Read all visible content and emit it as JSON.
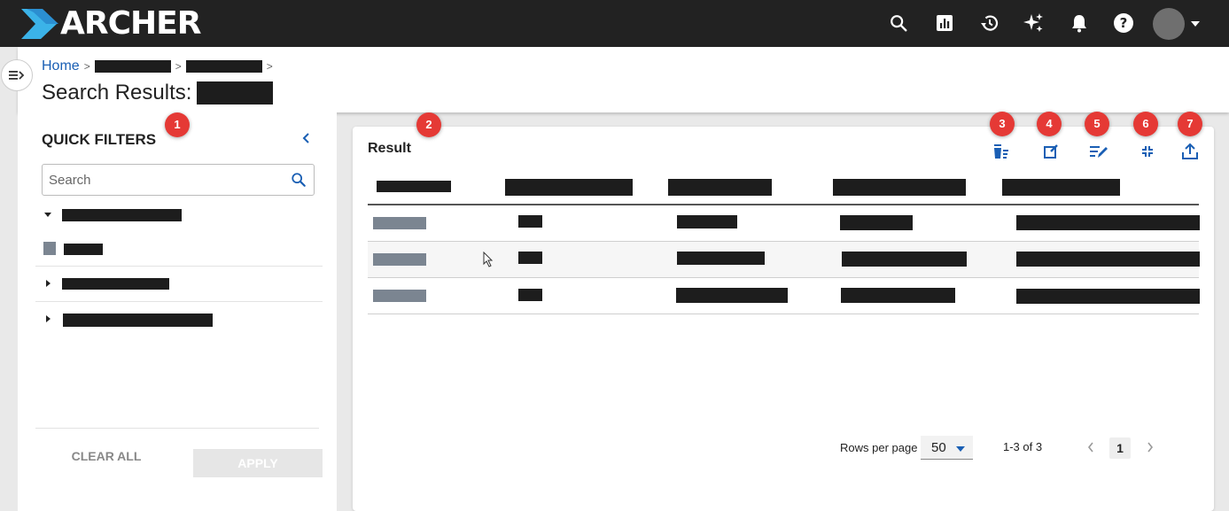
{
  "app": {
    "logo_text": "ARCHER",
    "colors": {
      "topbar": "#222222",
      "accent": "#1a5fb4",
      "badge": "#e53935"
    },
    "top_icons": [
      "search-icon",
      "reports-chart-icon",
      "history-icon",
      "ai-sparkle-icon",
      "bell-icon",
      "help-icon"
    ]
  },
  "header": {
    "breadcrumb_home": "Home",
    "breadcrumb_sep": ">",
    "title_prefix": "Search Results:"
  },
  "quick_filters": {
    "title": "QUICK FILTERS",
    "search_placeholder": "Search",
    "clear_label": "CLEAR ALL",
    "apply_label": "APPLY"
  },
  "results": {
    "title": "Result",
    "toolbar_icons": [
      "clear-sort-icon",
      "edit-record-icon",
      "edit-list-icon",
      "collapse-icon",
      "export-icon"
    ],
    "row_count": 3
  },
  "pagination": {
    "rows_per_page_label": "Rows per page",
    "rows_per_page_value": "50",
    "range_text": "1-3 of 3",
    "current_page": "1"
  },
  "annotations": {
    "badge_1": "1",
    "badge_2": "2",
    "badge_3": "3",
    "badge_4": "4",
    "badge_5": "5",
    "badge_6": "6",
    "badge_7": "7"
  }
}
